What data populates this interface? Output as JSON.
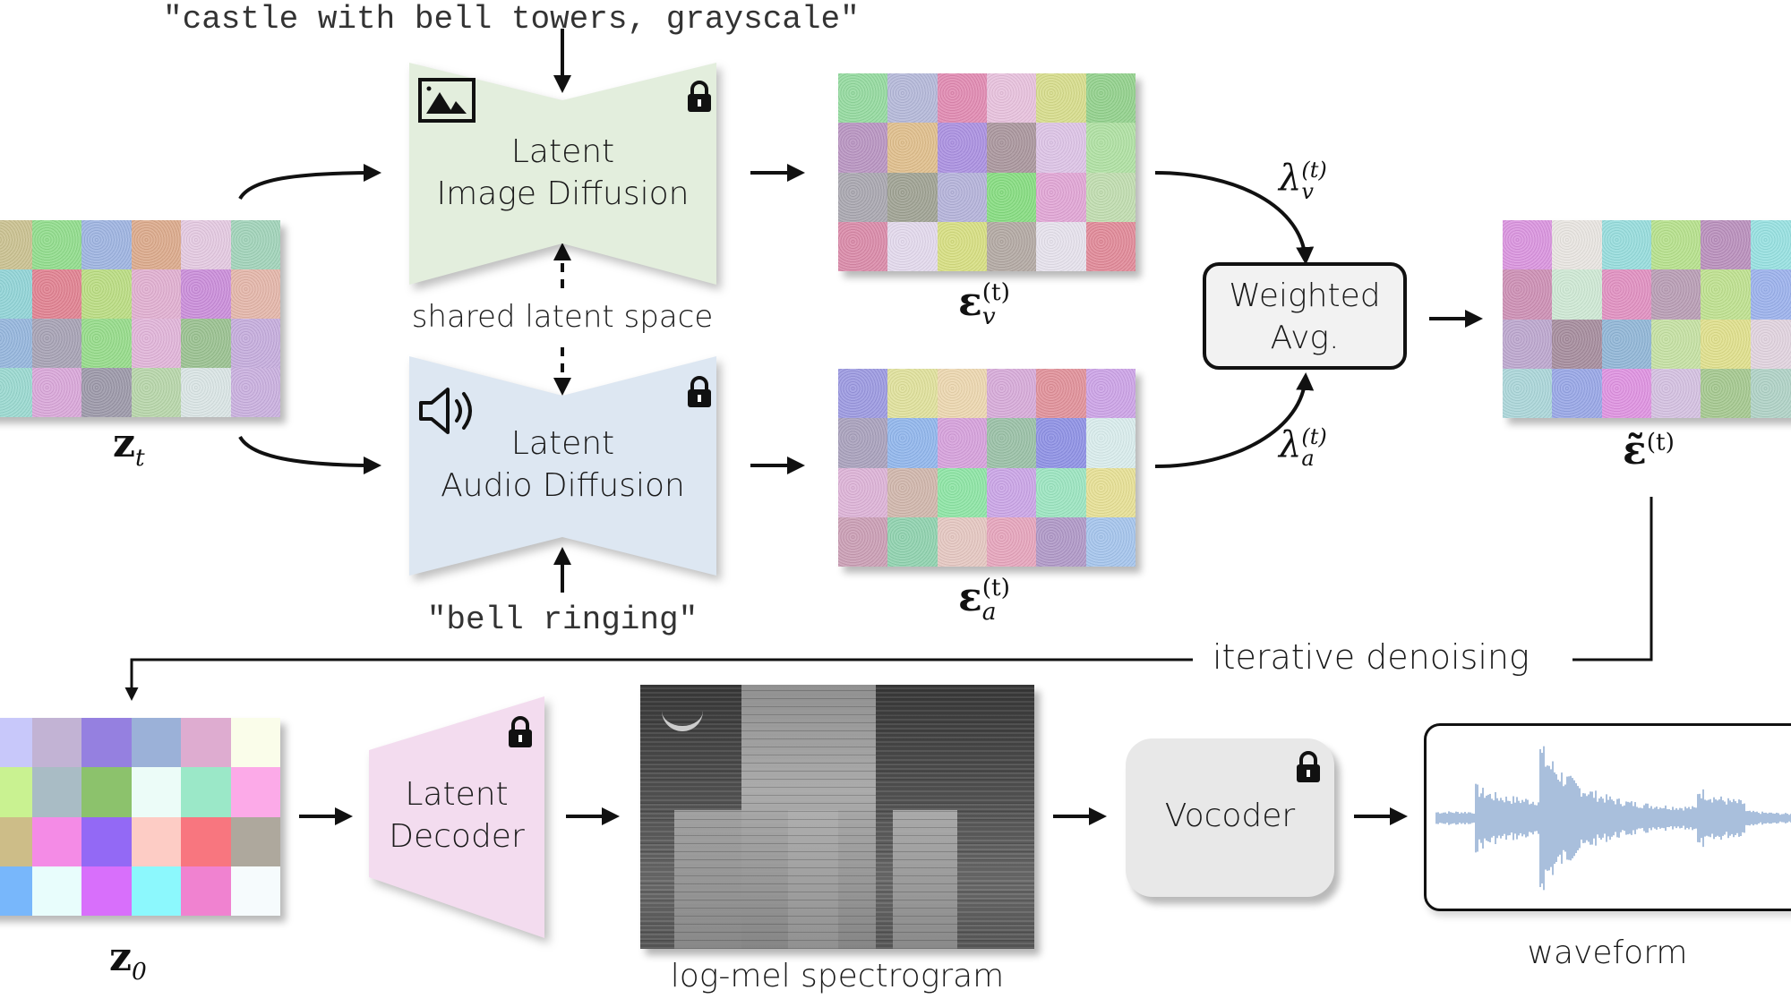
{
  "prompts": {
    "image_prompt": "\"castle with bell towers, grayscale\"",
    "audio_prompt": "\"bell ringing\""
  },
  "blocks": {
    "image_diffusion": {
      "line1": "Latent",
      "line2": "Image Diffusion",
      "icon": "image-icon",
      "locked": true
    },
    "audio_diffusion": {
      "line1": "Latent",
      "line2": "Audio Diffusion",
      "icon": "speaker-icon",
      "locked": true
    },
    "weighted_avg": {
      "line1": "Weighted",
      "line2": "Avg."
    },
    "latent_decoder": {
      "line1": "Latent",
      "line2": "Decoder",
      "locked": true
    },
    "vocoder": {
      "label": "Vocoder",
      "locked": true
    }
  },
  "labels": {
    "shared_latent_space": "shared latent space",
    "iterative_denoising": "iterative denoising",
    "log_mel_spectrogram": "log-mel spectrogram",
    "waveform": "waveform"
  },
  "math": {
    "z_t": {
      "base": "z",
      "sub": "t"
    },
    "eps_v": {
      "base": "ε",
      "sub": "v",
      "sup": "(t)"
    },
    "eps_a": {
      "base": "ε",
      "sub": "a",
      "sup": "(t)"
    },
    "lambda_v": {
      "base": "λ",
      "sub": "v",
      "sup": "(t)"
    },
    "lambda_a": {
      "base": "λ",
      "sub": "a",
      "sup": "(t)"
    },
    "eps_tilde": {
      "base": "ε̃",
      "sup": "(t)"
    },
    "z_0": {
      "base": "z",
      "sub": "0"
    }
  },
  "colors": {
    "image_block": "#e3eedd",
    "audio_block": "#dde7f2",
    "decoder_block": "#f3dcef",
    "vocoder_block": "#e8e8e8",
    "weighted_box": "#f2f2f2",
    "waveform": "#a9bfdc"
  },
  "grids": {
    "z_t": [
      "#c9c08e",
      "#8fdc8a",
      "#9cb2e0",
      "#dba889",
      "#e3c8e0",
      "#9fd2b8",
      "#8fd3d6",
      "#e07f8f",
      "#b9dc80",
      "#e0aed0",
      "#c98bd9",
      "#e3b5a8",
      "#93b4dc",
      "#a5a0b3",
      "#94db88",
      "#e0b3d8",
      "#98c08e",
      "#c4abdc",
      "#98d8cf",
      "#d8a5d8",
      "#9a96a7",
      "#b6d5a8",
      "#d9e4e4",
      "#c8aede"
    ],
    "eps_v": [
      "#92d99d",
      "#b3b7d8",
      "#e088b0",
      "#e7c0dc",
      "#d6dc8a",
      "#90d08a",
      "#b792c0",
      "#dfbd8a",
      "#a98ee0",
      "#a8949b",
      "#dcc2e5",
      "#aee0a1",
      "#a7a5ae",
      "#9da091",
      "#b3b1d9",
      "#84dc7e",
      "#e0a4d4",
      "#bfdcae",
      "#d988a7",
      "#e2d8ec",
      "#d6de7f",
      "#b1a7a1",
      "#e5e1ec",
      "#e08796"
    ],
    "eps_a": [
      "#9a97e0",
      "#dfe09a",
      "#ecd6ae",
      "#d6a9d8",
      "#e08f98",
      "#cba1e6",
      "#a79fbb",
      "#8fb5ec",
      "#d59fdb",
      "#98bfa5",
      "#8c8fe4",
      "#d8ecec",
      "#dcb1d6",
      "#cfb5aa",
      "#8be4a3",
      "#c9a3e6",
      "#9ae4bf",
      "#e6df93",
      "#c99cb3",
      "#8dd1ad",
      "#e4c6c0",
      "#e5a3bb",
      "#ae96c6",
      "#a3c3ec"
    ],
    "eps_tilde": [
      "#d992de",
      "#e8e4e0",
      "#95dcdc",
      "#b5e08a",
      "#b88dbb",
      "#95e0e0",
      "#cc8db3",
      "#cde8d3",
      "#e08ec0",
      "#b79bb3",
      "#bde08d",
      "#9ab0ec",
      "#bba5cd",
      "#a48a9b",
      "#8fb5d6",
      "#c4e0a1",
      "#dfdf8a",
      "#e0d2de",
      "#a9d5d8",
      "#96a5e6",
      "#de90e0",
      "#d3bfe0",
      "#a3c78d",
      "#aed1c5"
    ],
    "z_0": [
      "#c8c8fa",
      "#c2b3d4",
      "#9580e0",
      "#9bb1d8",
      "#deacd0",
      "#fafdea",
      "#c9f291",
      "#a9bcc5",
      "#8cc26c",
      "#ecfcf8",
      "#9be8c8",
      "#fcaae8",
      "#cdbd88",
      "#f48be6",
      "#9369f5",
      "#fdccc5",
      "#f8767f",
      "#aea89d",
      "#78b7fb",
      "#e8fdfc",
      "#d86ffb",
      "#8cf8fd",
      "#f082d0",
      "#f6fbfd"
    ]
  }
}
